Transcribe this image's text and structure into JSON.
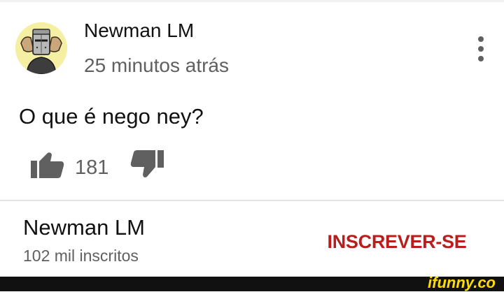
{
  "comment": {
    "author": "Newman LM",
    "timestamp": "25 minutos atrás",
    "text": "O que é nego ney?",
    "like_count": "181",
    "avatar_icon": "knight-avatar-icon",
    "menu_icon": "more-vertical-icon",
    "like_icon": "thumbs-up-icon",
    "dislike_icon": "thumbs-down-icon"
  },
  "channel": {
    "name": "Newman LM",
    "subscribers": "102 mil inscritos",
    "subscribe_label": "INSCREVER-SE"
  },
  "footer": {
    "watermark": "ifunny.co"
  },
  "colors": {
    "subscribe_red": "#bb1c1c",
    "text_primary": "#111111",
    "text_secondary": "#606060",
    "avatar_bg": "#f4efa2",
    "watermark_yellow": "#ffdc00"
  }
}
